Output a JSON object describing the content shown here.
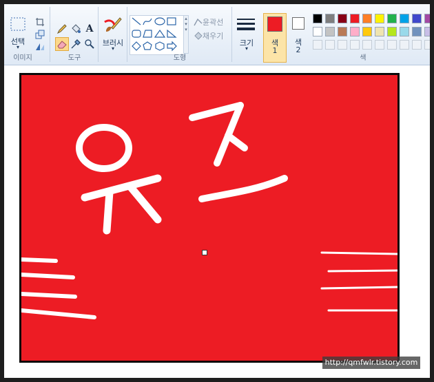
{
  "ribbon": {
    "image": {
      "select_label": "선택",
      "group_label": "이미지"
    },
    "tools": {
      "group_label": "도구",
      "text_tool_glyph": "A"
    },
    "brush": {
      "label": "브러시"
    },
    "shapes": {
      "outline_label": "윤곽선",
      "fill_label": "채우기",
      "group_label": "도형"
    },
    "size": {
      "label": "크기"
    },
    "color1": {
      "label_line1": "색",
      "label_line2": "1",
      "value": "#ed1c24"
    },
    "color2": {
      "label_line1": "색",
      "label_line2": "2",
      "value": "#ffffff"
    },
    "colors": {
      "group_label": "색",
      "row1": [
        "#000000",
        "#7f7f7f",
        "#880015",
        "#ed1c24",
        "#ff7f27",
        "#fff200",
        "#22b14c",
        "#00a2e8",
        "#3f48cc",
        "#a349a4"
      ],
      "row2": [
        "#ffffff",
        "#c3c3c3",
        "#b97a57",
        "#ffaec9",
        "#ffc90e",
        "#efe4b0",
        "#b5e61d",
        "#99d9ea",
        "#7092be",
        "#c8bfe7"
      ]
    }
  },
  "canvas": {
    "background": "#ed1c24",
    "drawing_text": "유즈"
  },
  "watermark": {
    "text": "http://qmfwlr.tistory.com"
  }
}
